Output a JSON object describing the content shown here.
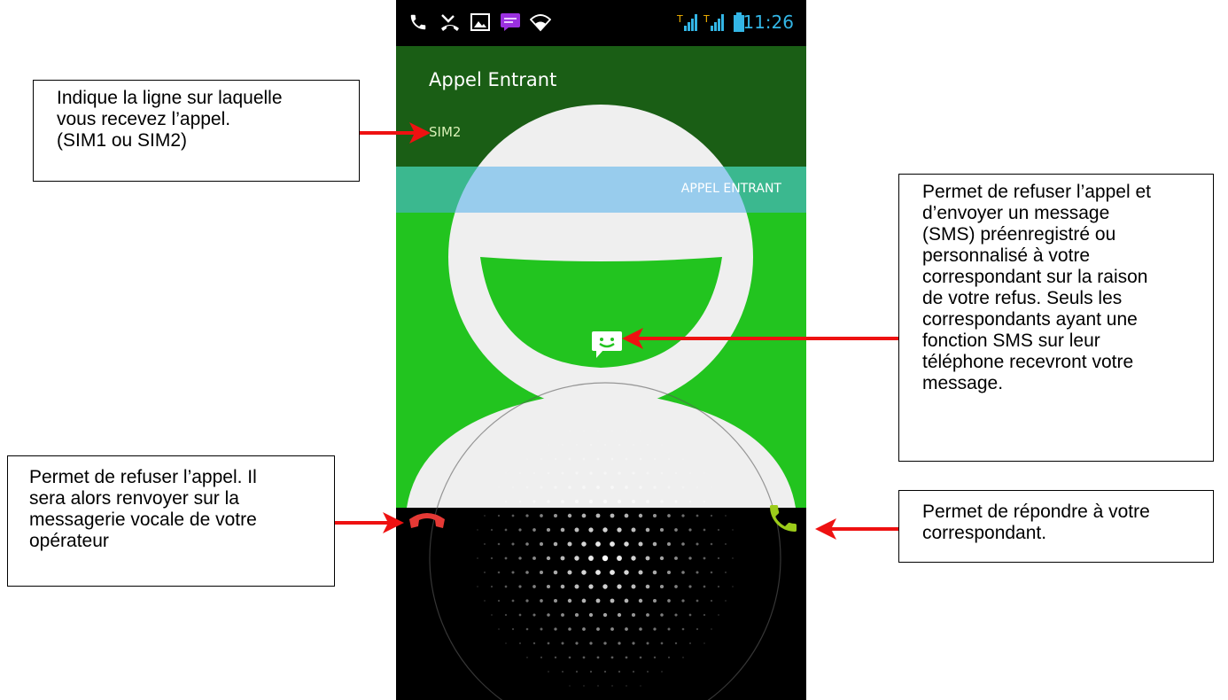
{
  "status_bar": {
    "time": "11:26",
    "icons": [
      "phone-call-icon",
      "missed-call-icon",
      "image-icon",
      "message-notification-icon",
      "wifi-icon",
      "sim1-signal-icon",
      "sim2-signal-icon",
      "battery-icon"
    ]
  },
  "incoming_call": {
    "title": "Appel Entrant",
    "sim_line": "SIM2",
    "status_label": "APPEL ENTRANT"
  },
  "controls": {
    "decline_icon": "decline-call-icon",
    "answer_icon": "answer-call-icon",
    "sms_icon": "sms-reply-icon"
  },
  "annotations": {
    "sim_line": "Indique la ligne sur laquelle\nvous recevez l’appel.\n(SIM1 ou SIM2)",
    "sms_reply": "Permet de refuser l’appel et\nd’envoyer un message\n(SMS) préenregistré ou\npersonnalisé à votre\ncorrespondant sur la raison\nde votre refus. Seuls les\ncorrespondants ayant une\nfonction SMS sur leur\ntéléphone recevront votre\nmessage.",
    "decline": "Permet de refuser l’appel. Il\nsera alors renvoyer sur la\nmessagerie vocale de votre\nopérateur",
    "answer": "Permet de répondre à votre\ncorrespondant."
  },
  "colors": {
    "header_bg": "#1a5e15",
    "body_green": "#22c41f",
    "banner_blue": "#50afeb",
    "decline_red": "#e53935",
    "answer_green": "#9ccc1a",
    "arrow_red": "#ee1111"
  }
}
